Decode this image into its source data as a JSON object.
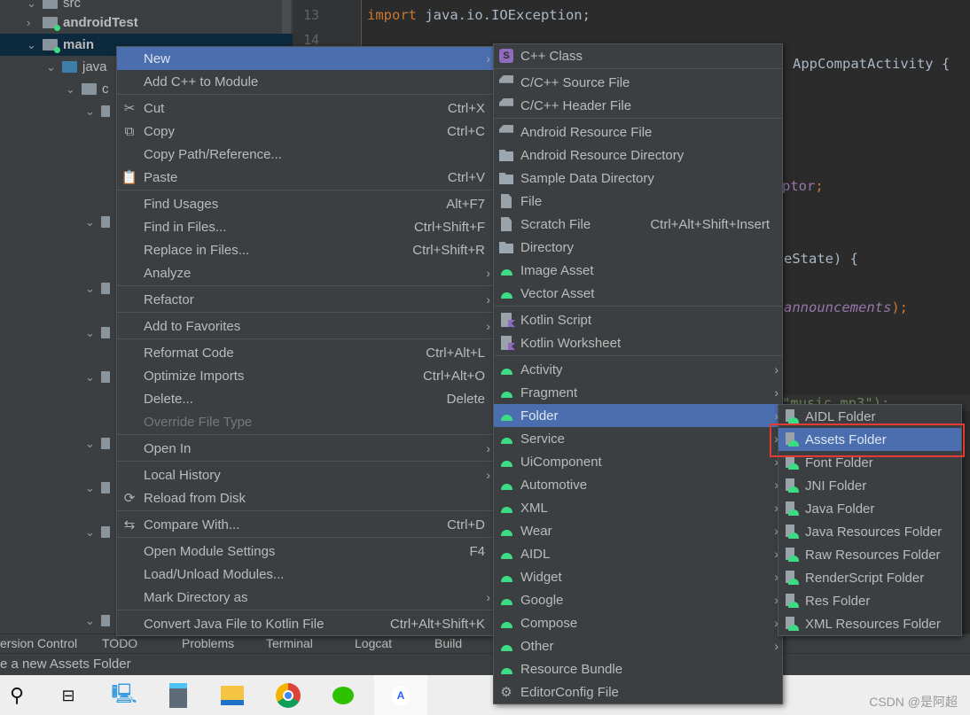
{
  "project_tree": {
    "items": [
      {
        "label": "src",
        "icon": "folder-icon",
        "expanded": true
      },
      {
        "label": "androidTest",
        "icon": "module-folder-icon",
        "expanded": false
      },
      {
        "label": "main",
        "icon": "module-folder-icon",
        "expanded": true,
        "selected": true
      },
      {
        "label": "java",
        "icon": "source-folder-icon",
        "expanded": true
      },
      {
        "label": "c",
        "icon": "package-icon",
        "expanded": true
      }
    ]
  },
  "editor": {
    "line_numbers": [
      "13",
      "14"
    ],
    "import_keyword": "import",
    "import_rest": " java.io.IOException;",
    "frag_class": "AppCompatActivity {",
    "frag_ptor": "ptor",
    "frag_semicolon": ";",
    "frag_state": "eState) {",
    "frag_announcements": "announcements",
    "frag_paren": ");",
    "frag_music": "\"music.mp3\");"
  },
  "context_menu": [
    {
      "label": "New",
      "submenu": true,
      "highlighted": true
    },
    {
      "label": "Add C++ to Module",
      "sep_after": true
    },
    {
      "label": "Cut",
      "shortcut": "Ctrl+X",
      "icon": "scissors-icon"
    },
    {
      "label": "Copy",
      "shortcut": "Ctrl+C",
      "icon": "copy-icon"
    },
    {
      "label": "Copy Path/Reference..."
    },
    {
      "label": "Paste",
      "shortcut": "Ctrl+V",
      "icon": "paste-icon",
      "sep_after": true
    },
    {
      "label": "Find Usages",
      "shortcut": "Alt+F7"
    },
    {
      "label": "Find in Files...",
      "shortcut": "Ctrl+Shift+F"
    },
    {
      "label": "Replace in Files...",
      "shortcut": "Ctrl+Shift+R"
    },
    {
      "label": "Analyze",
      "submenu": true,
      "sep_after": true
    },
    {
      "label": "Refactor",
      "submenu": true,
      "sep_after": true
    },
    {
      "label": "Add to Favorites",
      "submenu": true,
      "sep_after": true
    },
    {
      "label": "Reformat Code",
      "shortcut": "Ctrl+Alt+L"
    },
    {
      "label": "Optimize Imports",
      "shortcut": "Ctrl+Alt+O"
    },
    {
      "label": "Delete...",
      "shortcut": "Delete"
    },
    {
      "label": "Override File Type",
      "disabled": true,
      "sep_after": true
    },
    {
      "label": "Open In",
      "submenu": true,
      "sep_after": true
    },
    {
      "label": "Local History",
      "submenu": true
    },
    {
      "label": "Reload from Disk",
      "icon": "reload-icon",
      "sep_after": true
    },
    {
      "label": "Compare With...",
      "shortcut": "Ctrl+D",
      "icon": "compare-icon",
      "sep_after": true
    },
    {
      "label": "Open Module Settings",
      "shortcut": "F4"
    },
    {
      "label": "Load/Unload Modules..."
    },
    {
      "label": "Mark Directory as",
      "submenu": true,
      "sep_after": true
    },
    {
      "label": "Convert Java File to Kotlin File",
      "shortcut": "Ctrl+Alt+Shift+K"
    }
  ],
  "new_submenu": [
    {
      "label": "C++ Class",
      "icon": "cpp-class-icon",
      "sep_after": true
    },
    {
      "label": "C/C++ Source File",
      "icon": "cpp-source-icon"
    },
    {
      "label": "C/C++ Header File",
      "icon": "cpp-header-icon",
      "sep_after": true
    },
    {
      "label": "Android Resource File",
      "icon": "android-resource-file-icon"
    },
    {
      "label": "Android Resource Directory",
      "icon": "folder-icon"
    },
    {
      "label": "Sample Data Directory",
      "icon": "folder-icon"
    },
    {
      "label": "File",
      "icon": "file-icon"
    },
    {
      "label": "Scratch File",
      "shortcut": "Ctrl+Alt+Shift+Insert",
      "icon": "scratch-file-icon"
    },
    {
      "label": "Directory",
      "icon": "folder-icon"
    },
    {
      "label": "Image Asset",
      "icon": "android-icon"
    },
    {
      "label": "Vector Asset",
      "icon": "android-icon",
      "sep_after": true
    },
    {
      "label": "Kotlin Script",
      "icon": "kotlin-icon"
    },
    {
      "label": "Kotlin Worksheet",
      "icon": "kotlin-icon",
      "sep_after": true
    },
    {
      "label": "Activity",
      "icon": "android-icon",
      "submenu": true
    },
    {
      "label": "Fragment",
      "icon": "android-icon",
      "submenu": true
    },
    {
      "label": "Folder",
      "icon": "android-icon",
      "submenu": true,
      "highlighted": true
    },
    {
      "label": "Service",
      "icon": "android-icon",
      "submenu": true
    },
    {
      "label": "UiComponent",
      "icon": "android-icon",
      "submenu": true
    },
    {
      "label": "Automotive",
      "icon": "android-icon",
      "submenu": true
    },
    {
      "label": "XML",
      "icon": "android-icon",
      "submenu": true
    },
    {
      "label": "Wear",
      "icon": "android-icon",
      "submenu": true
    },
    {
      "label": "AIDL",
      "icon": "android-icon",
      "submenu": true
    },
    {
      "label": "Widget",
      "icon": "android-icon",
      "submenu": true
    },
    {
      "label": "Google",
      "icon": "android-icon",
      "submenu": true
    },
    {
      "label": "Compose",
      "icon": "android-icon",
      "submenu": true
    },
    {
      "label": "Other",
      "icon": "android-icon",
      "submenu": true
    },
    {
      "label": "Resource Bundle",
      "icon": "resource-bundle-icon"
    },
    {
      "label": "EditorConfig File",
      "icon": "gear-icon"
    }
  ],
  "folder_submenu": [
    {
      "label": "AIDL Folder"
    },
    {
      "label": "Assets Folder",
      "highlighted": true
    },
    {
      "label": "Font Folder"
    },
    {
      "label": "JNI Folder"
    },
    {
      "label": "Java Folder"
    },
    {
      "label": "Java Resources Folder"
    },
    {
      "label": "Raw Resources Folder"
    },
    {
      "label": "RenderScript Folder"
    },
    {
      "label": "Res Folder"
    },
    {
      "label": "XML Resources Folder"
    }
  ],
  "tool_windows": [
    "ersion Control",
    "TODO",
    "Problems",
    "Terminal",
    "Logcat",
    "Build"
  ],
  "status_text": "e a new Assets Folder",
  "taskbar": {
    "icons": [
      "search-icon",
      "task-view-icon",
      "this-pc-icon",
      "calculator-icon",
      "file-explorer-icon",
      "chrome-icon",
      "wechat-icon",
      "android-studio-icon"
    ],
    "watermark": "CSDN @是阿超"
  },
  "colors": {
    "menu_bg": "#3c3f41",
    "highlight": "#4b6eaf",
    "annotation_box": "#e53935",
    "android_green": "#3ddc84"
  }
}
